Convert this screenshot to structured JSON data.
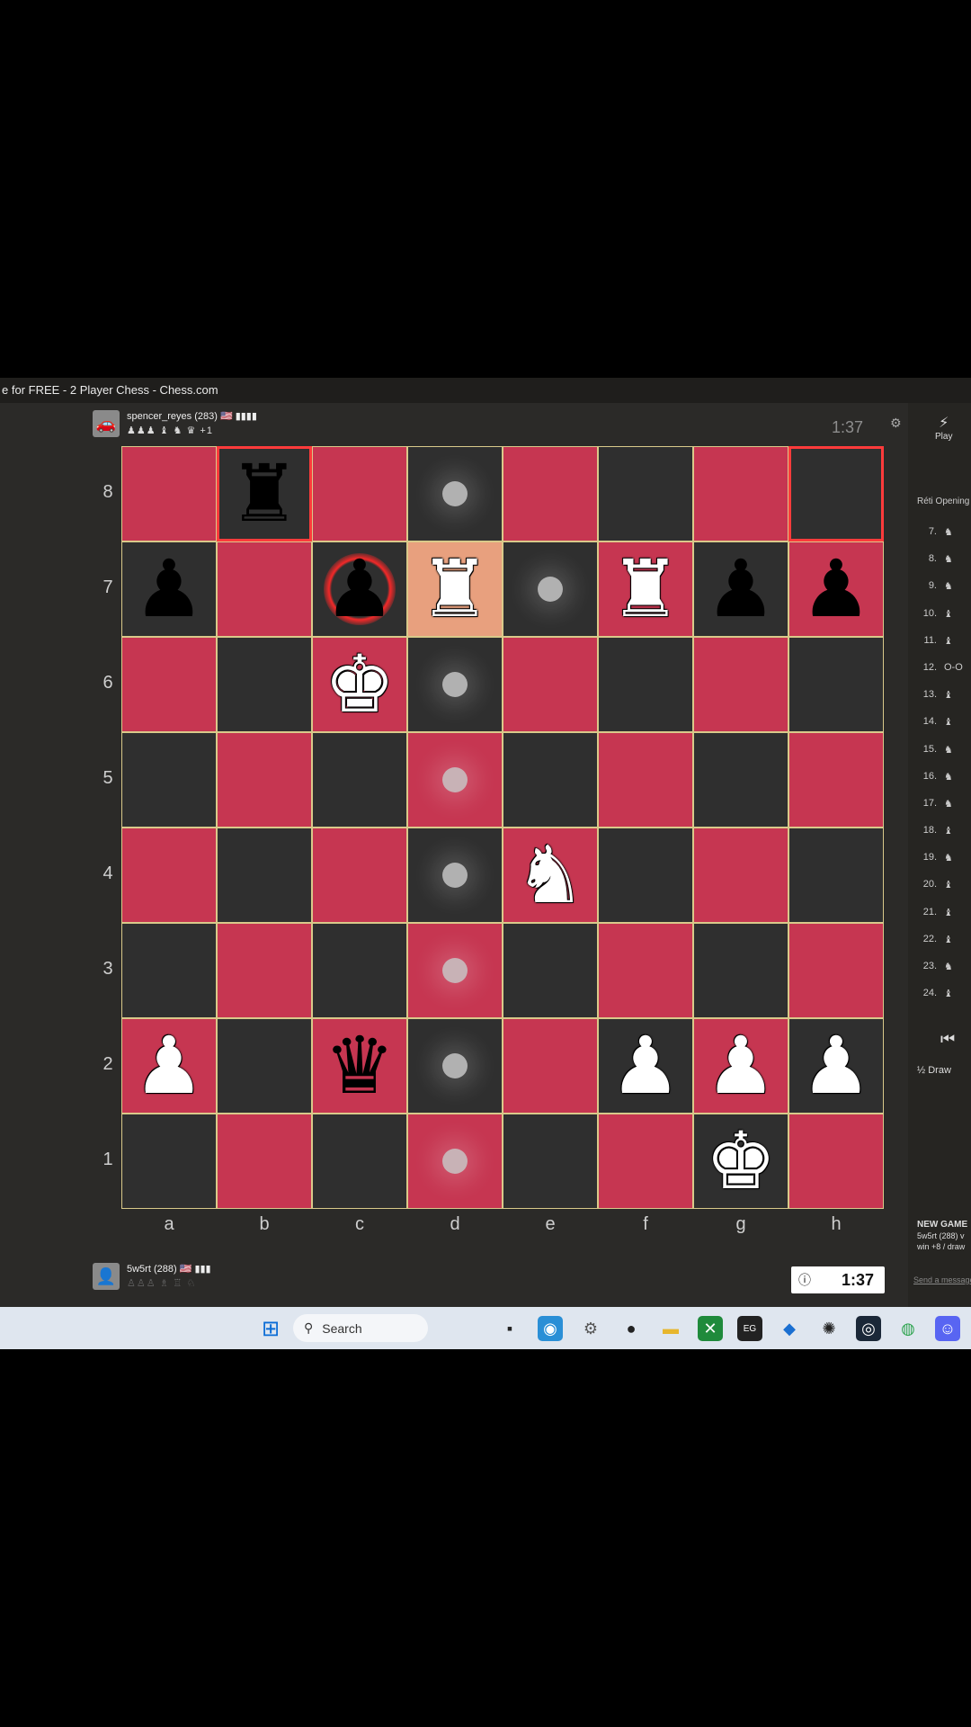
{
  "window": {
    "title": "e for FREE - 2 Player Chess - Chess.com"
  },
  "top_player": {
    "name": "spencer_reyes (283) 🇺🇸 ▮▮▮▮",
    "captured": "♟♟♟ ♝ ♞ ♛ +1",
    "clock": "1:37"
  },
  "bottom_player": {
    "name": "5w5rt (288) 🇺🇸 ▮▮▮",
    "captured": "♙♙♙ ♗ ♖ ♘",
    "clock": "1:37"
  },
  "board": {
    "ranks": [
      "8",
      "7",
      "6",
      "5",
      "4",
      "3",
      "2",
      "1"
    ],
    "files": [
      "a",
      "b",
      "c",
      "d",
      "e",
      "f",
      "g",
      "h"
    ],
    "squares": [
      [
        "",
        "b-rook",
        "",
        "dot",
        "",
        "",
        "",
        ""
      ],
      [
        "b-pawn",
        "",
        "b-pawn",
        "w-rook",
        "dot",
        "w-rook",
        "b-pawn",
        "b-pawn"
      ],
      [
        "",
        "",
        "w-king",
        "dot",
        "",
        "",
        "",
        ""
      ],
      [
        "",
        "",
        "",
        "dot",
        "",
        "",
        "",
        ""
      ],
      [
        "",
        "",
        "",
        "dot",
        "w-knight",
        "",
        "",
        ""
      ],
      [
        "",
        "",
        "",
        "dot",
        "",
        "",
        "",
        ""
      ],
      [
        "w-pawn",
        "",
        "b-queen",
        "dot",
        "",
        "w-pawn",
        "w-pawn",
        "w-pawn"
      ],
      [
        "",
        "",
        "",
        "dot",
        "",
        "",
        "w-king",
        ""
      ]
    ],
    "glyphs": {
      "w-king": "♚",
      "w-queen": "♛",
      "w-rook": "♜",
      "w-bishop": "♝",
      "w-knight": "♞",
      "w-pawn": "♟",
      "b-king": "♚",
      "b-queen": "♛",
      "b-rook": "♜",
      "b-bishop": "♝",
      "b-knight": "♞",
      "b-pawn": "♟"
    },
    "highlighted_square": "d7",
    "attacked_square": "c7",
    "outlined_squares": [
      "b8",
      "h8"
    ]
  },
  "sidebar": {
    "play_label": "Play",
    "opening": "Réti Opening",
    "moves": [
      {
        "n": "7.",
        "m": "♞"
      },
      {
        "n": "8.",
        "m": "♞"
      },
      {
        "n": "9.",
        "m": "♞"
      },
      {
        "n": "10.",
        "m": "♝"
      },
      {
        "n": "11.",
        "m": "♝"
      },
      {
        "n": "12.",
        "m": "O-O"
      },
      {
        "n": "13.",
        "m": "♝"
      },
      {
        "n": "14.",
        "m": "♝"
      },
      {
        "n": "15.",
        "m": "♞"
      },
      {
        "n": "16.",
        "m": "♞"
      },
      {
        "n": "17.",
        "m": "♞"
      },
      {
        "n": "18.",
        "m": "♝"
      },
      {
        "n": "19.",
        "m": "♞"
      },
      {
        "n": "20.",
        "m": "♝"
      },
      {
        "n": "21.",
        "m": "♝"
      },
      {
        "n": "22.",
        "m": "♝"
      },
      {
        "n": "23.",
        "m": "♞"
      },
      {
        "n": "24.",
        "m": "♝"
      }
    ],
    "draw_label": "½ Draw",
    "new_game_title": "NEW GAME",
    "new_game_line1": "5w5rt (288) v",
    "new_game_line2": "win +8 / draw",
    "send_link": "Send a message"
  },
  "taskbar": {
    "search_placeholder": "Search"
  }
}
